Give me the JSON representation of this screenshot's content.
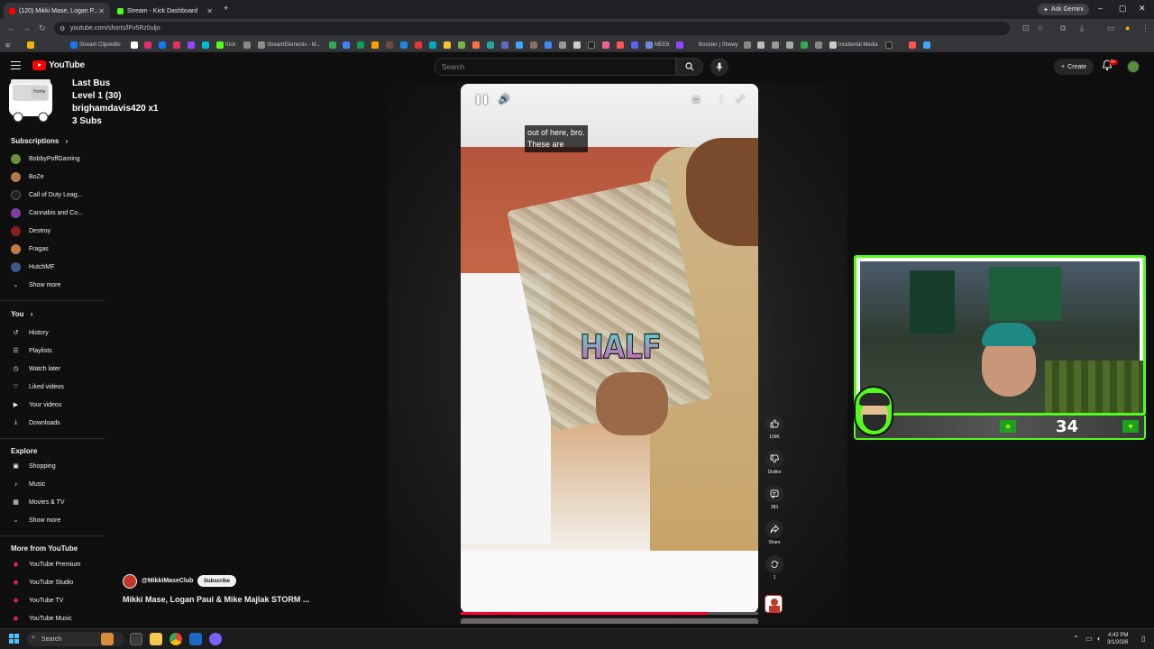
{
  "browser": {
    "tabs": [
      {
        "title": "(120) Mikki Mase, Logan P...",
        "active": true,
        "favicon_color": "#ff0000"
      },
      {
        "title": "Stream - Kick Dashboard",
        "active": false,
        "favicon_color": "#53fc18"
      }
    ],
    "new_tab": "+",
    "ask_gemini": "Ask Gemini",
    "url": "youtube.com/shorts/lFv5Rz0uljo",
    "window_controls": {
      "minimize": "–",
      "maximize": "▢",
      "close": "✕"
    }
  },
  "bookmarks": [
    {
      "label": "",
      "color": "#f4b400"
    },
    {
      "label": "Stream Clip/edits",
      "color": "#1a73e8"
    },
    {
      "label": "",
      "color": "#ffffff"
    },
    {
      "label": "",
      "color": "#e1306c"
    },
    {
      "label": "Kick",
      "color": "#53fc18"
    },
    {
      "label": "StreamElements - M...",
      "color": "#8e8e8e"
    },
    {
      "label": "MEE6",
      "color": "#7289da"
    },
    {
      "label": "Booster | Showy",
      "color": "#aaaaaa"
    },
    {
      "label": "Incidental Media",
      "color": "#cccccc"
    }
  ],
  "youtube": {
    "logo_text": "YouTube",
    "search_placeholder": "Search",
    "create_label": "Create",
    "notification_count": "9+"
  },
  "stream_overlay": {
    "bus_label": "Home",
    "line1": "Last Bus",
    "line2": "Level 1  (30)",
    "line3": "brighamdavis420 x1",
    "line4": "3 Subs"
  },
  "sidebar": {
    "subscriptions_title": "Subscriptions",
    "subscriptions": [
      {
        "name": "BobbyPoffGaming",
        "color": "#6a8f3a"
      },
      {
        "name": "BoZe",
        "color": "#b07a4a"
      },
      {
        "name": "Call of Duty Leag...",
        "color": "#222222"
      },
      {
        "name": "Cannabis and Co...",
        "color": "#7b3fa0"
      },
      {
        "name": "Destroy",
        "color": "#8a1e1e"
      },
      {
        "name": "Fragas",
        "color": "#c27b45"
      },
      {
        "name": "HutchMF",
        "color": "#3b5a8a"
      }
    ],
    "show_more_1": "Show more",
    "you_title": "You",
    "you_items": [
      {
        "label": "History",
        "icon": "history-icon",
        "glyph": "↺"
      },
      {
        "label": "Playlists",
        "icon": "playlists-icon",
        "glyph": "☰"
      },
      {
        "label": "Watch later",
        "icon": "clock-icon",
        "glyph": "◷"
      },
      {
        "label": "Liked videos",
        "icon": "thumbs-up-icon",
        "glyph": "👍"
      },
      {
        "label": "Your videos",
        "icon": "video-icon",
        "glyph": "▶"
      },
      {
        "label": "Downloads",
        "icon": "download-icon",
        "glyph": "⤓"
      }
    ],
    "explore_title": "Explore",
    "explore_items": [
      {
        "label": "Shopping",
        "icon": "shopping-bag-icon",
        "glyph": "▣"
      },
      {
        "label": "Music",
        "icon": "music-note-icon",
        "glyph": "♪"
      },
      {
        "label": "Movies & TV",
        "icon": "film-icon",
        "glyph": "▦"
      }
    ],
    "show_more_2": "Show more",
    "more_title": "More from YouTube",
    "more_items": [
      {
        "label": "YouTube Premium"
      },
      {
        "label": "YouTube Studio"
      },
      {
        "label": "YouTube TV"
      },
      {
        "label": "YouTube Music"
      }
    ]
  },
  "player": {
    "caption_line1": "out of here, bro.",
    "caption_line2": "These are",
    "overlay_word": "HALF",
    "progress": 0.83
  },
  "actions": {
    "like_count": "109K",
    "dislike_label": "Dislike",
    "comments_count": "383",
    "share_label": "Share",
    "remix_count": "1"
  },
  "channel": {
    "handle": "@MikkiMaseClub",
    "subscribe_label": "Subscribe",
    "video_title": "Mikki Mase, Logan Paul & Mike Majlak STORM ..."
  },
  "webcam_overlay": {
    "count": "34",
    "star_glyph": "★",
    "heart_glyph": "♥",
    "accent": "#53fc18"
  },
  "taskbar": {
    "search_label": "Search",
    "time": "4:42 PM",
    "date": "3/1/2026"
  }
}
